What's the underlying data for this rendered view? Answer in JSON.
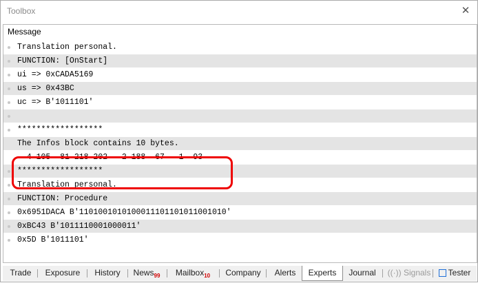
{
  "window": {
    "title": "Toolbox",
    "close_glyph": "✕"
  },
  "header": {
    "message_label": "Message"
  },
  "rows": [
    {
      "text": "Translation personal."
    },
    {
      "text": "FUNCTION: [OnStart]"
    },
    {
      "text": "ui => 0xCADA5169"
    },
    {
      "text": "us => 0x43BC"
    },
    {
      "text": "uc => B'1011101'"
    },
    {
      "text": ""
    },
    {
      "text": "******************"
    },
    {
      "text": "The Infos block contains 10 bytes."
    },
    {
      "text": "  4 105  81 218 202   2 188  67   1  93"
    },
    {
      "text": "******************"
    },
    {
      "text": "Translation personal."
    },
    {
      "text": "FUNCTION: Procedure"
    },
    {
      "text": "0x6951DACA B'1101001010100011101101011001010'"
    },
    {
      "text": "0xBC43 B'1011110001000011'"
    },
    {
      "text": "0x5D B'1011101'"
    }
  ],
  "tabs": {
    "trade": "Trade",
    "exposure": "Exposure",
    "history": "History",
    "news": "News",
    "news_count": "99",
    "mailbox": "Mailbox",
    "mailbox_count": "10",
    "company": "Company",
    "alerts": "Alerts",
    "experts": "Experts",
    "journal": "Journal",
    "signals": "Signals",
    "tester": "Tester"
  },
  "icons": {
    "close": "close-icon",
    "signals": "signals-icon",
    "tester": "tester-chip-icon"
  },
  "colors": {
    "highlight": "#ee0000",
    "alt_row": "#e4e4e4",
    "badge": "#d00000"
  }
}
